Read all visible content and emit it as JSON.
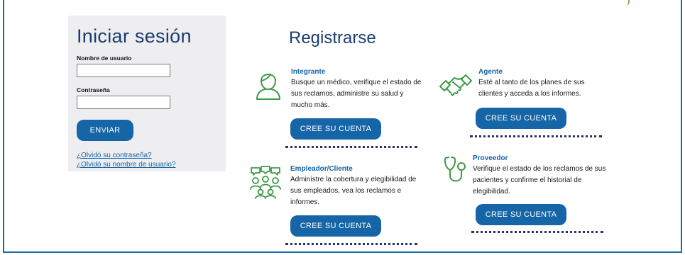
{
  "login": {
    "title": "Iniciar sesión",
    "username_label": "Nombre de usuario",
    "username_value": "",
    "password_label": "Contraseña",
    "password_value": "",
    "submit_label": "ENVIAR",
    "forgot_password": "¿Olvidó su contraseña?",
    "forgot_username": "¿Olvidó su nombre de usuario?"
  },
  "register": {
    "title": "Registrarse",
    "create_label": "CREE SU CUENTA",
    "cards": [
      {
        "title": "Integrante",
        "text": "Busque un médico, verifique el estado de sus reclamos, administre su salud y mucho más.",
        "icon": "member-icon"
      },
      {
        "title": "Agente",
        "text": "Esté al tanto de los planes de sus clientes y acceda a los informes.",
        "icon": "handshake-icon"
      },
      {
        "title": "Empleador/Cliente",
        "text": "Administre la cobertura y elegibilidad de sus empleados, vea los reclamos e informes.",
        "icon": "group-icon"
      },
      {
        "title": "Proveedor",
        "text": "Verifique el estado de los reclamos de sus pacientes y confirme el historial de elegibilidad.",
        "icon": "stethoscope-icon"
      }
    ]
  },
  "colors": {
    "primary": "#1565a7",
    "title": "#1b3d6e",
    "icon": "#3f9a47",
    "panel": "#eeeef1"
  }
}
